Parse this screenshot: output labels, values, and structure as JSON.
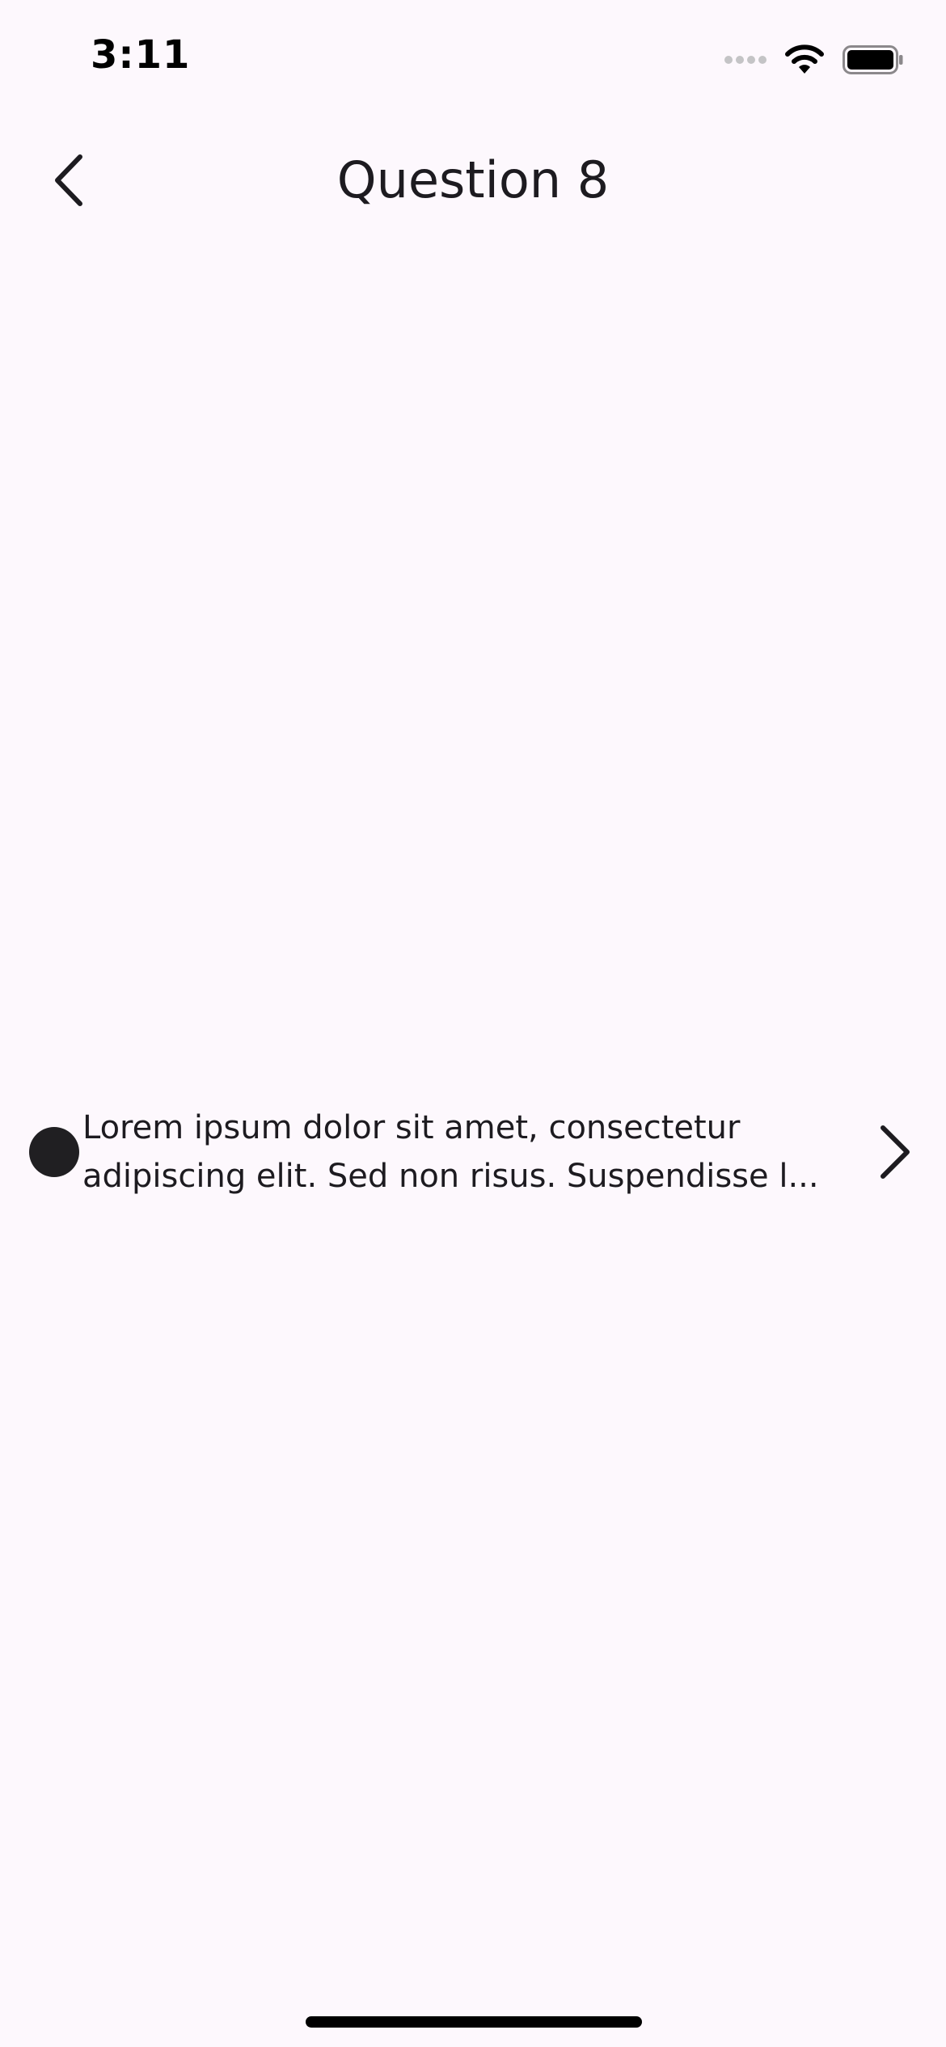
{
  "status_bar": {
    "time": "3:11",
    "signal_icon": "signal-dots-icon",
    "wifi_icon": "wifi-icon",
    "battery_icon": "battery-icon"
  },
  "app_bar": {
    "back_icon": "chevron-left-icon",
    "title": "Question 8"
  },
  "list": {
    "items": [
      {
        "text": "Lorem ipsum dolor sit amet, consectetur adipiscing elit. Sed non risus. Suspendisse l...",
        "leading_icon": "filled-circle-icon",
        "trailing_icon": "chevron-right-icon"
      }
    ]
  },
  "colors": {
    "background": "#fdf8fd",
    "text": "#1d1b20",
    "bullet": "#201f22"
  }
}
